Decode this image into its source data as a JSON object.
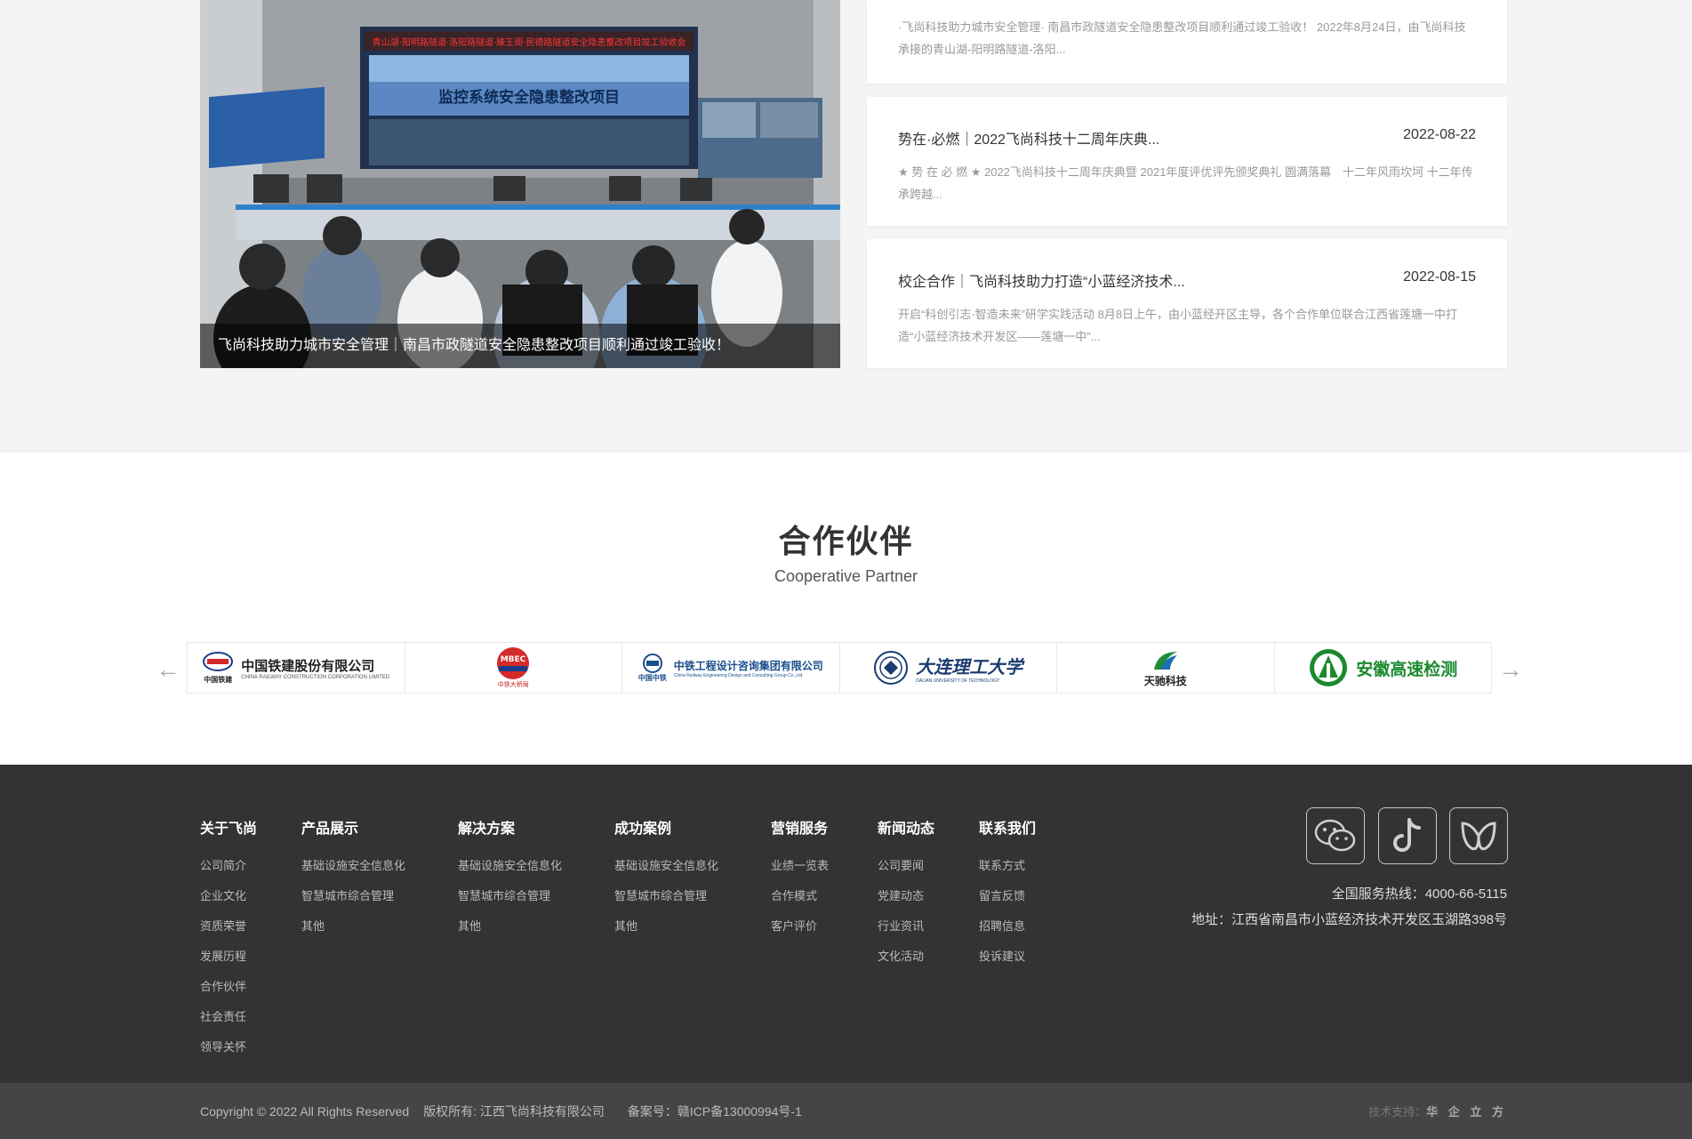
{
  "news": {
    "feature_caption": "飞尚科技助力城市安全管理｜南昌市政隧道安全隐患整改项目顺利通过竣工验收！",
    "feature_banner_top": "青山湖·阳明路隧道·洛阳路隧道·滕王阁·民德路隧道安全隐患整改项目竣工验收会",
    "feature_screen_text": "监控系统安全隐患整改项目",
    "items": [
      {
        "title": "",
        "date": "",
        "desc": "·飞尚科技助力城市安全管理· 南昌市政隧道安全隐患整改项目顺利通过竣工验收！ 2022年8月24日，由飞尚科技承接的青山湖-阳明路隧道-洛阳..."
      },
      {
        "title": "势在·必燃｜2022飞尚科技十二周年庆典...",
        "date": "2022-08-22",
        "desc": "★ 势 在 必 燃 ★ 2022飞尚科技十二周年庆典暨 2021年度评优评先颁奖典礼 圆满落幕　十二年风雨坎坷 十二年传承跨越..."
      },
      {
        "title": "校企合作｜飞尚科技助力打造“小蓝经济技术...",
        "date": "2022-08-15",
        "desc": "开启“科创引志·智造未来”研学实践活动 8月8日上午，由小蓝经开区主导，各个合作单位联合江西省莲塘一中打造“小蓝经济技术开发区——莲塘一中”..."
      }
    ]
  },
  "partners": {
    "title": "合作伙伴",
    "subtitle": "Cooperative Partner",
    "prev_arrow": "←",
    "next_arrow": "→",
    "logos": [
      {
        "text": "中国铁建股份有限公司",
        "sub": "CHINA RAILWAY CONSTRUCTION CORPORATION LIMITED",
        "mark": "中国铁建"
      },
      {
        "text": "MBEC",
        "sub": "中铁大桥局"
      },
      {
        "text": "中铁工程设计咨询集团有限公司",
        "sub": "China Railway Engineering Design and Consulting Group Co.,Ltd.",
        "mark": "中国中铁"
      },
      {
        "text": "大连理工大学",
        "sub": "DALIAN UNIVERSITY OF TECHNOLOGY"
      },
      {
        "text": "天驰科技",
        "sub": ""
      },
      {
        "text": "安徽高速检测",
        "sub": ""
      }
    ]
  },
  "footer": {
    "columns": [
      {
        "head": "关于飞尚",
        "items": [
          "公司简介",
          "企业文化",
          "资质荣誉",
          "发展历程",
          "合作伙伴",
          "社会责任",
          "领导关怀"
        ]
      },
      {
        "head": "产品展示",
        "items": [
          "基础设施安全信息化",
          "智慧城市综合管理",
          "其他"
        ]
      },
      {
        "head": "解决方案",
        "items": [
          "基础设施安全信息化",
          "智慧城市综合管理",
          "其他"
        ]
      },
      {
        "head": "成功案例",
        "items": [
          "基础设施安全信息化",
          "智慧城市综合管理",
          "其他"
        ]
      },
      {
        "head": "营销服务",
        "items": [
          "业绩一览表",
          "合作模式",
          "客户评价"
        ]
      },
      {
        "head": "新闻动态",
        "items": [
          "公司要闻",
          "党建动态",
          "行业资讯",
          "文化活动"
        ]
      },
      {
        "head": "联系我们",
        "items": [
          "联系方式",
          "留言反馈",
          "招聘信息",
          "投诉建议"
        ]
      }
    ],
    "social_icons": [
      "wechat-icon",
      "douyin-icon",
      "weibo-icon"
    ],
    "hotline": "全国服务热线：4000-66-5115",
    "address": "地址：江西省南昌市小蓝经济技术开发区玉湖路398号",
    "copyright": "Copyright © 2022 All Rights Reserved",
    "owner": "版权所有: 江西飞尚科技有限公司",
    "icp": "备案号：赣ICP备13000994号-1",
    "tech_label": "技术支持：",
    "tech_name": "华 企 立 方"
  }
}
